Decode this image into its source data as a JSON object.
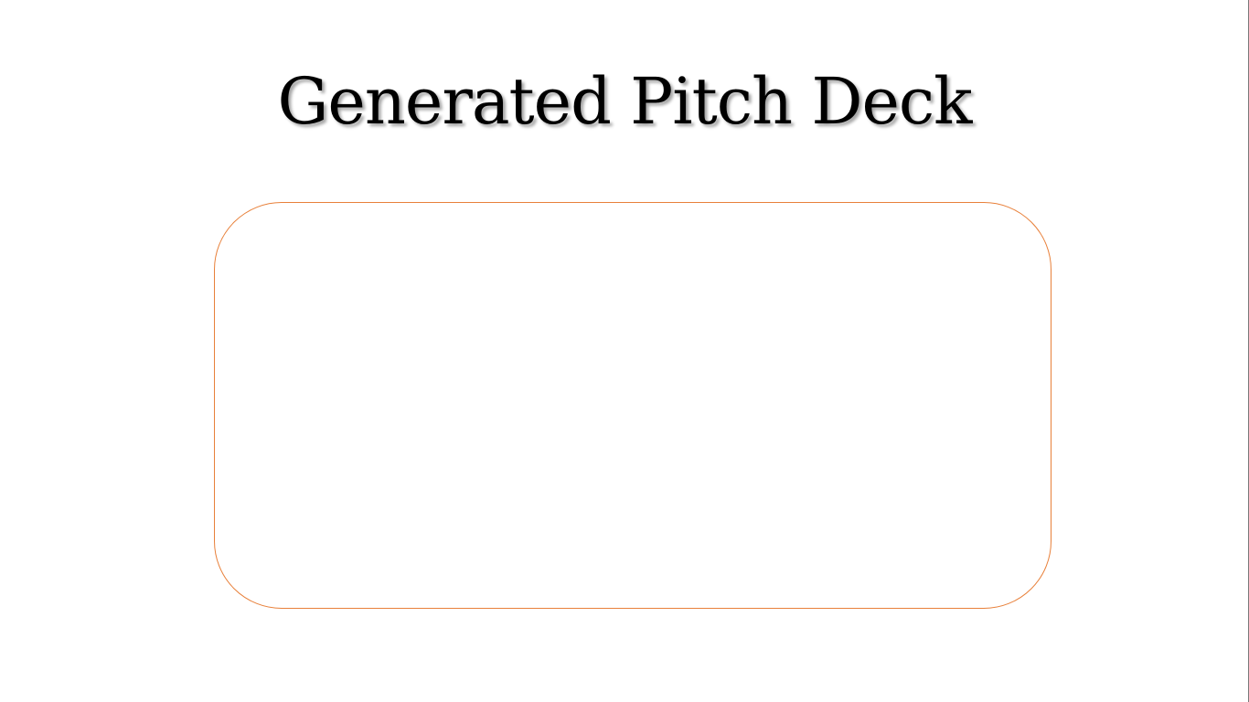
{
  "slide": {
    "title": "Generated Pitch Deck"
  },
  "colors": {
    "background": "#ffffff",
    "title_text": "#000000",
    "content_box_border": "#e8803a"
  }
}
